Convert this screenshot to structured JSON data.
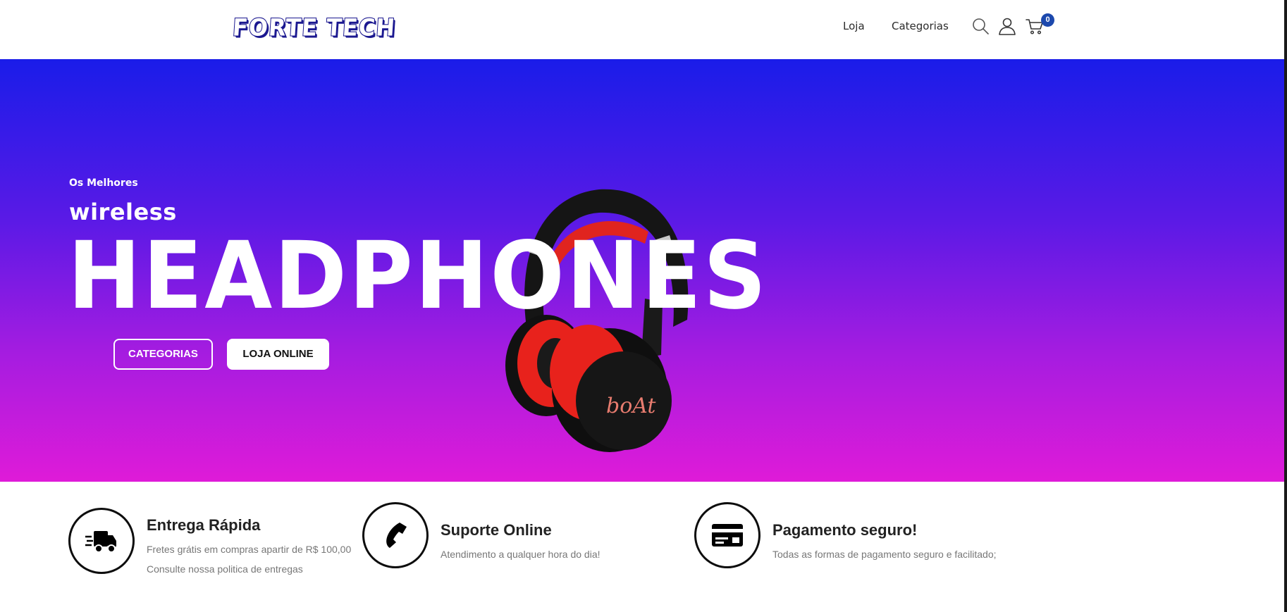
{
  "header": {
    "logo_text": "FORTE TECH",
    "nav": {
      "loja": "Loja",
      "categorias": "Categorias"
    },
    "cart_count": "0"
  },
  "hero": {
    "eyebrow": "Os Melhores",
    "subtitle": "wireless",
    "headline": "HEADPHONES",
    "buttons": {
      "categorias": "CATEGORIAS",
      "loja_online": "LOJA ONLINE"
    },
    "product_brand": "boAt"
  },
  "features": [
    {
      "title": "Entrega Rápida",
      "lines": [
        "Fretes grátis em compras apartir de R$ 100,00",
        "Consulte nossa politica de entregas"
      ],
      "icon": "delivery-truck-icon"
    },
    {
      "title": "Suporte Online",
      "lines": [
        "Atendimento a qualquer hora do dia!"
      ],
      "icon": "phone-icon"
    },
    {
      "title": "Pagamento seguro!",
      "lines": [
        "Todas as formas de pagamento seguro e facilitado;"
      ],
      "icon": "credit-card-icon"
    }
  ],
  "colors": {
    "hero_gradient_top": "#1a1ce9",
    "hero_gradient_bottom": "#df1bd8",
    "cart_badge": "#1c48ad",
    "logo_outline": "#1b1890"
  }
}
